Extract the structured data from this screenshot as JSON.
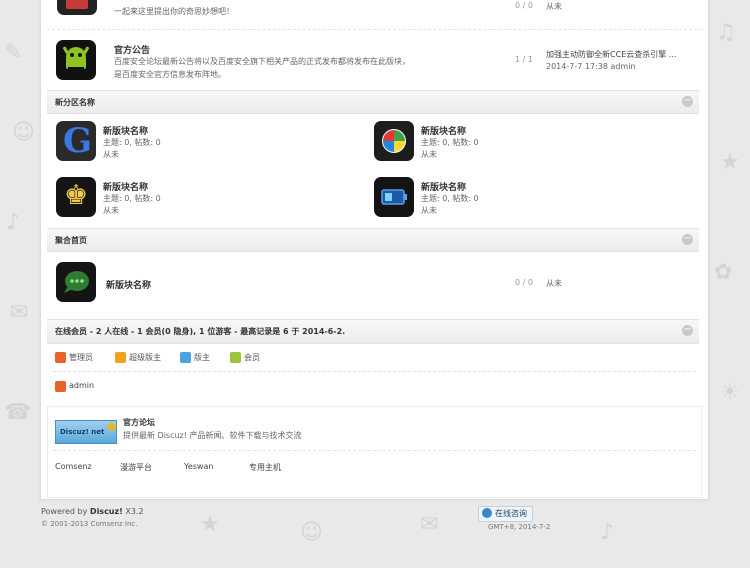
{
  "top_forum": {
    "desc": "一起来这里提出你的奇思妙想吧！",
    "stats": "0 / 0",
    "last": "从未"
  },
  "announce_forum": {
    "title": "官方公告",
    "desc_line1": "百度安全论坛最新公告将以及百度安全旗下相关产品的正式发布都将发布在此版块，",
    "desc_line2": "是百度安全官方信息发布阵地。",
    "stats": "1 / 1",
    "last_title": "加强主动防御全新CCE云查杀引擎 ...",
    "last_meta": "2014-7-7 17:38 admin"
  },
  "section_new": {
    "title": "新分区名称",
    "forums": [
      {
        "name": "新版块名称",
        "stats": "主题: 0, 帖数: 0",
        "last": "从未",
        "icon": "google-g-icon"
      },
      {
        "name": "新版块名称",
        "stats": "主题: 0, 帖数: 0",
        "last": "从未",
        "icon": "windows-logo-icon"
      },
      {
        "name": "新版块名称",
        "stats": "主题: 0, 帖数: 0",
        "last": "从未",
        "icon": "chess-king-icon"
      },
      {
        "name": "新版块名称",
        "stats": "主题: 0, 帖数: 0",
        "last": "从未",
        "icon": "battery-icon"
      }
    ]
  },
  "section_agg": {
    "title": "聚合首页",
    "forum": {
      "name": "新版块名称",
      "stats": "0 / 0",
      "last": "从未"
    }
  },
  "online": {
    "title": "在线会员 - 2 人在线 - 1 会员(0 隐身), 1 位游客 - 最高记录是 6 于 2014-6-2.",
    "legend": [
      {
        "label": "管理员",
        "color": "#e8622b"
      },
      {
        "label": "超级版主",
        "color": "#f0a21e"
      },
      {
        "label": "版主",
        "color": "#4aa3df"
      },
      {
        "label": "会员",
        "color": "#9bc53d"
      }
    ],
    "user": "admin",
    "user_color": "#e8622b"
  },
  "links": {
    "logo_text": "Discuz! net",
    "title": "官方论坛",
    "desc": "提供最新 Discuz! 产品新闻、软件下载与技术交流",
    "items": [
      "Comsenz",
      "漫游平台",
      "Yeswan",
      "专用主机"
    ]
  },
  "footer": {
    "powered_prefix": "Powered by",
    "brand": "Discuz!",
    "version": "X3.2",
    "copyright": "© 2001-2013 Comsenz Inc.",
    "online_service": "在线咨询",
    "time": "GMT+8, 2014-7-2"
  }
}
